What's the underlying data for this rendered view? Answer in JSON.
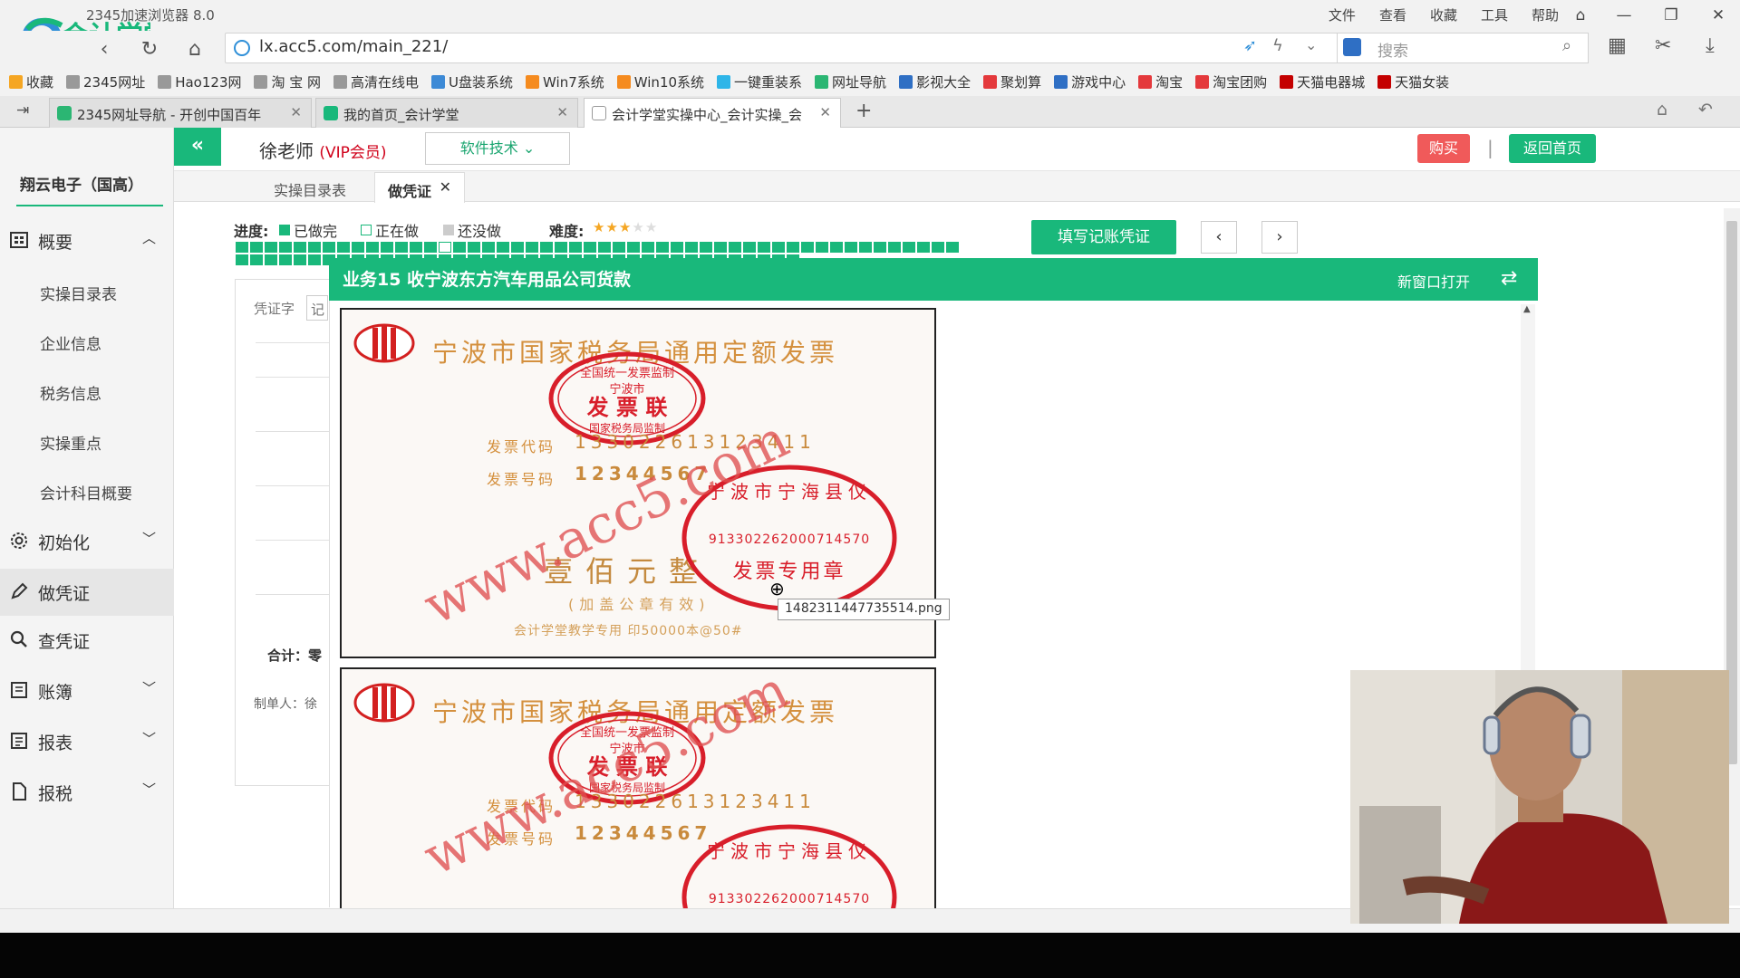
{
  "browser": {
    "app_title": "2345加速浏览器 8.0",
    "menus": [
      "文件",
      "查看",
      "收藏",
      "工具",
      "帮助"
    ],
    "url": "lx.acc5.com/main_221/",
    "search_placeholder": "搜索",
    "bookmarks": [
      {
        "label": "收藏",
        "color": "#f5a623"
      },
      {
        "label": "2345网址",
        "color": "#999999"
      },
      {
        "label": "Hao123网",
        "color": "#999999"
      },
      {
        "label": "淘 宝 网",
        "color": "#999999"
      },
      {
        "label": "高清在线电",
        "color": "#999999"
      },
      {
        "label": "U盘装系统",
        "color": "#3d8ad6"
      },
      {
        "label": "Win7系统",
        "color": "#f58b1f"
      },
      {
        "label": "Win10系统",
        "color": "#f58b1f"
      },
      {
        "label": "一键重装系",
        "color": "#2eb5e8"
      },
      {
        "label": "网址导航",
        "color": "#2bb673"
      },
      {
        "label": "影视大全",
        "color": "#2f6fc4"
      },
      {
        "label": "聚划算",
        "color": "#e4393c"
      },
      {
        "label": "游戏中心",
        "color": "#2f6fc4"
      },
      {
        "label": "淘宝",
        "color": "#e4393c"
      },
      {
        "label": "淘宝团购",
        "color": "#e4393c"
      },
      {
        "label": "天猫电器城",
        "color": "#c40000"
      },
      {
        "label": "天猫女装",
        "color": "#c40000"
      }
    ],
    "tabs": [
      {
        "label": "2345网址导航 - 开创中国百年",
        "color": "#2bb673"
      },
      {
        "label": "我的首页_会计学堂",
        "color": "#19b87b"
      },
      {
        "label": "会计学堂实操中心_会计实操_会",
        "color": "#999999"
      }
    ]
  },
  "logo_text": "会计学堂",
  "sidebar": {
    "company": "翔云电子（国高）",
    "items": [
      {
        "label": "概要",
        "icon": "grid-icon",
        "expanded": true
      },
      {
        "label": "初始化",
        "icon": "gear-icon"
      },
      {
        "label": "做凭证",
        "icon": "pen-icon",
        "active": true
      },
      {
        "label": "查凭证",
        "icon": "search-icon"
      },
      {
        "label": "账簿",
        "icon": "book-icon"
      },
      {
        "label": "报表",
        "icon": "report-icon"
      },
      {
        "label": "报税",
        "icon": "file-icon"
      }
    ],
    "sub_items": [
      "实操目录表",
      "企业信息",
      "税务信息",
      "实操重点",
      "会计科目概要"
    ]
  },
  "header": {
    "collapse": "«",
    "teacher": "徐老师",
    "vip": "(VIP会员)",
    "software_tech": "软件技术",
    "buy": "购买",
    "separator": "|",
    "home": "返回首页"
  },
  "subtabs": {
    "list": "实操目录表",
    "active": "做凭证"
  },
  "progress": {
    "label": "进度:",
    "done": "已做完",
    "doing": "正在做",
    "todo": "还没做",
    "difficulty_label": "难度:",
    "difficulty_stars": 3,
    "difficulty_max": 5,
    "total_tasks": 89,
    "current_task": 15,
    "colors": {
      "done": "#19b87b",
      "doing": "#ffffff",
      "todo": "#cccccc",
      "star": "#f5a623"
    }
  },
  "actions": {
    "fill_voucher": "填写记账凭证",
    "prev": "‹",
    "next": "›"
  },
  "voucher": {
    "label": "凭证字",
    "type": "记",
    "total": "合计：零",
    "maker": "制单人：徐"
  },
  "business": {
    "title": "业务15 收宁波东方汽车用品公司货款",
    "new_window": "新窗口打开"
  },
  "invoice": {
    "title": "宁波市国家税务局通用定额发票",
    "stamp_top_text": "全国统一发票监制",
    "stamp_city": "宁波市",
    "stamp_main": "发 票 联",
    "stamp_bottom": "国家税务局监制",
    "code_label": "发票代码",
    "code": "133022613123411",
    "number_label": "发票号码",
    "number": "12344567",
    "seal_text": "宁波市宁海县仪",
    "seal_tax_id": "913302262000714570",
    "seal_label": "发票专用章",
    "amount": "壹佰元整",
    "note": "(加盖公章有效)",
    "footer": "会计学堂教学专用 印50000本@50#",
    "watermark": "www.acc5.com"
  },
  "tooltip": "1482311447735514.png",
  "accent_color": "#19b87b"
}
